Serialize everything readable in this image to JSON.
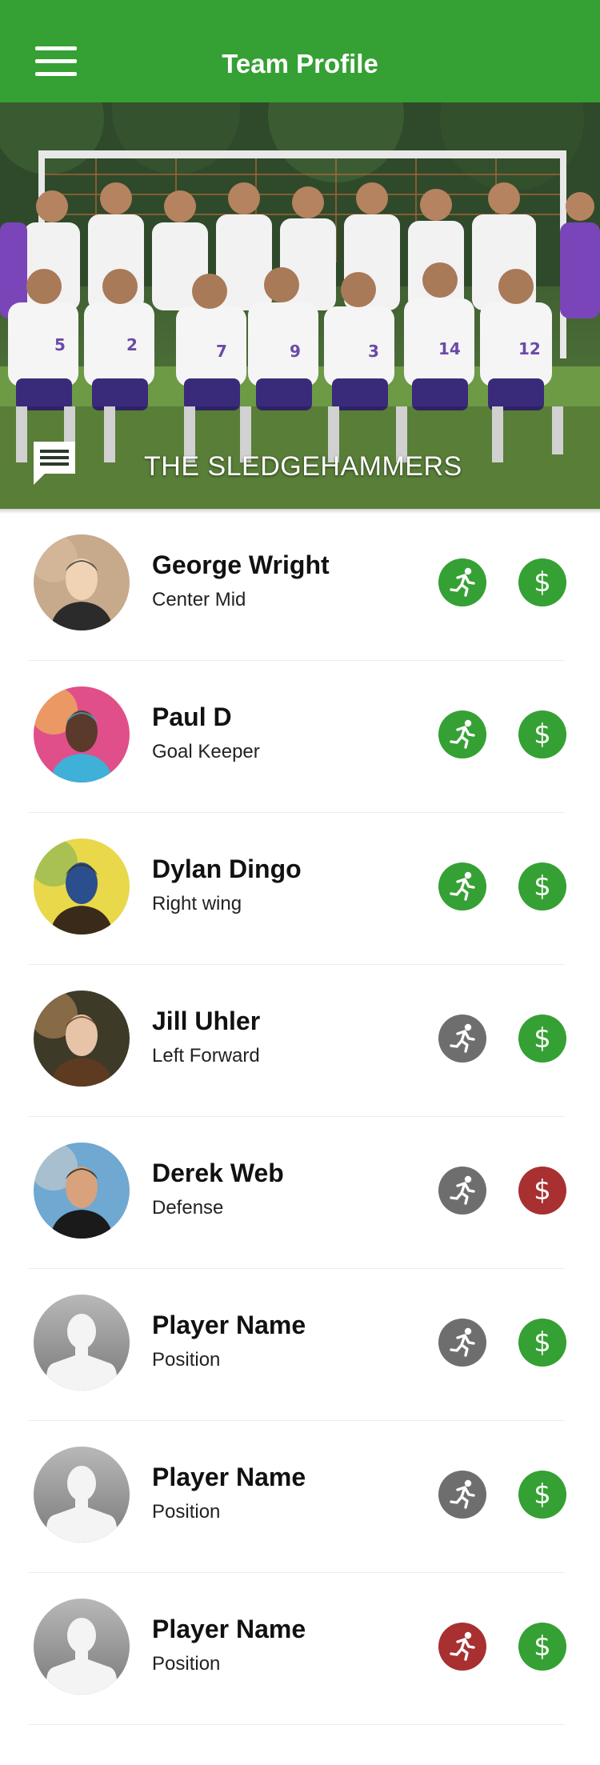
{
  "header": {
    "title": "Team Profile",
    "menu_icon": "hamburger-menu-icon"
  },
  "hero": {
    "team_name": "THE SLEDGEHAMMERS",
    "chat_icon": "chat-icon",
    "image_subject": "team photo of soccer players in white and purple kits in front of a goal"
  },
  "colors": {
    "brand_green": "#35a033",
    "status_green": "#35a033",
    "status_gray": "#6e6e6e",
    "status_red": "#a83030"
  },
  "players": [
    {
      "name": "George Wright",
      "position": "Center Mid",
      "avatar": "photo",
      "attendance_status": "green",
      "payment_status": "green"
    },
    {
      "name": "Paul D",
      "position": "Goal Keeper",
      "avatar": "photo",
      "attendance_status": "green",
      "payment_status": "green"
    },
    {
      "name": "Dylan Dingo",
      "position": "Right wing",
      "avatar": "photo",
      "attendance_status": "green",
      "payment_status": "green"
    },
    {
      "name": "Jill Uhler",
      "position": "Left Forward",
      "avatar": "photo",
      "attendance_status": "gray",
      "payment_status": "green"
    },
    {
      "name": "Derek Web",
      "position": "Defense",
      "avatar": "photo",
      "attendance_status": "gray",
      "payment_status": "red"
    },
    {
      "name": "Player Name",
      "position": "Position",
      "avatar": "placeholder",
      "attendance_status": "gray",
      "payment_status": "green"
    },
    {
      "name": "Player Name",
      "position": "Position",
      "avatar": "placeholder",
      "attendance_status": "gray",
      "payment_status": "green"
    },
    {
      "name": "Player Name",
      "position": "Position",
      "avatar": "placeholder",
      "attendance_status": "red",
      "payment_status": "green"
    }
  ],
  "icons": {
    "attendance": "running-person-icon",
    "payment": "dollar-icon"
  },
  "payment_glyph": "$"
}
